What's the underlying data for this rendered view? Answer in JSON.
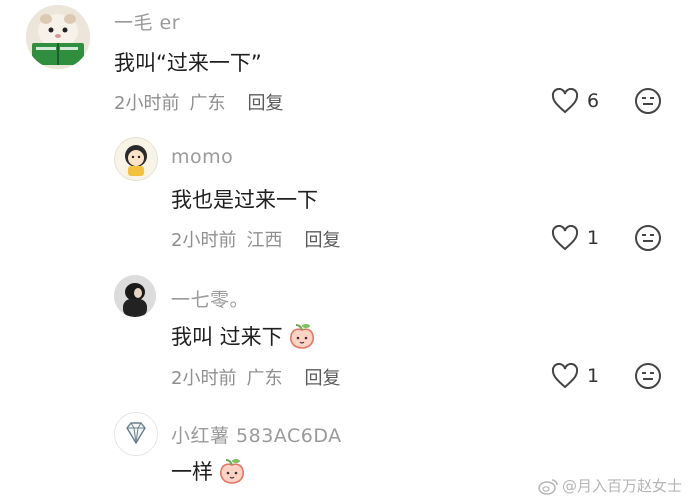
{
  "comments": [
    {
      "username": "一毛 er",
      "text": "我叫“过来一下”",
      "time": "2小时前",
      "location": "广东",
      "reply_label": "回复",
      "likes": "6"
    },
    {
      "username": "momo",
      "text": "我也是过来一下",
      "time": "2小时前",
      "location": "江西",
      "reply_label": "回复",
      "likes": "1"
    },
    {
      "username": "一七零。",
      "text": "我叫 过来下",
      "time": "2小时前",
      "location": "广东",
      "reply_label": "回复",
      "likes": "1"
    },
    {
      "username": "小红薯 583AC6DA",
      "text": "一样"
    }
  ],
  "watermark": "@月入百万赵女士",
  "icons": {
    "like": "heart-outline-icon",
    "dislike": "neutral-face-icon",
    "emoji": "peach-emoji-icon",
    "weibo": "weibo-logo-icon"
  }
}
